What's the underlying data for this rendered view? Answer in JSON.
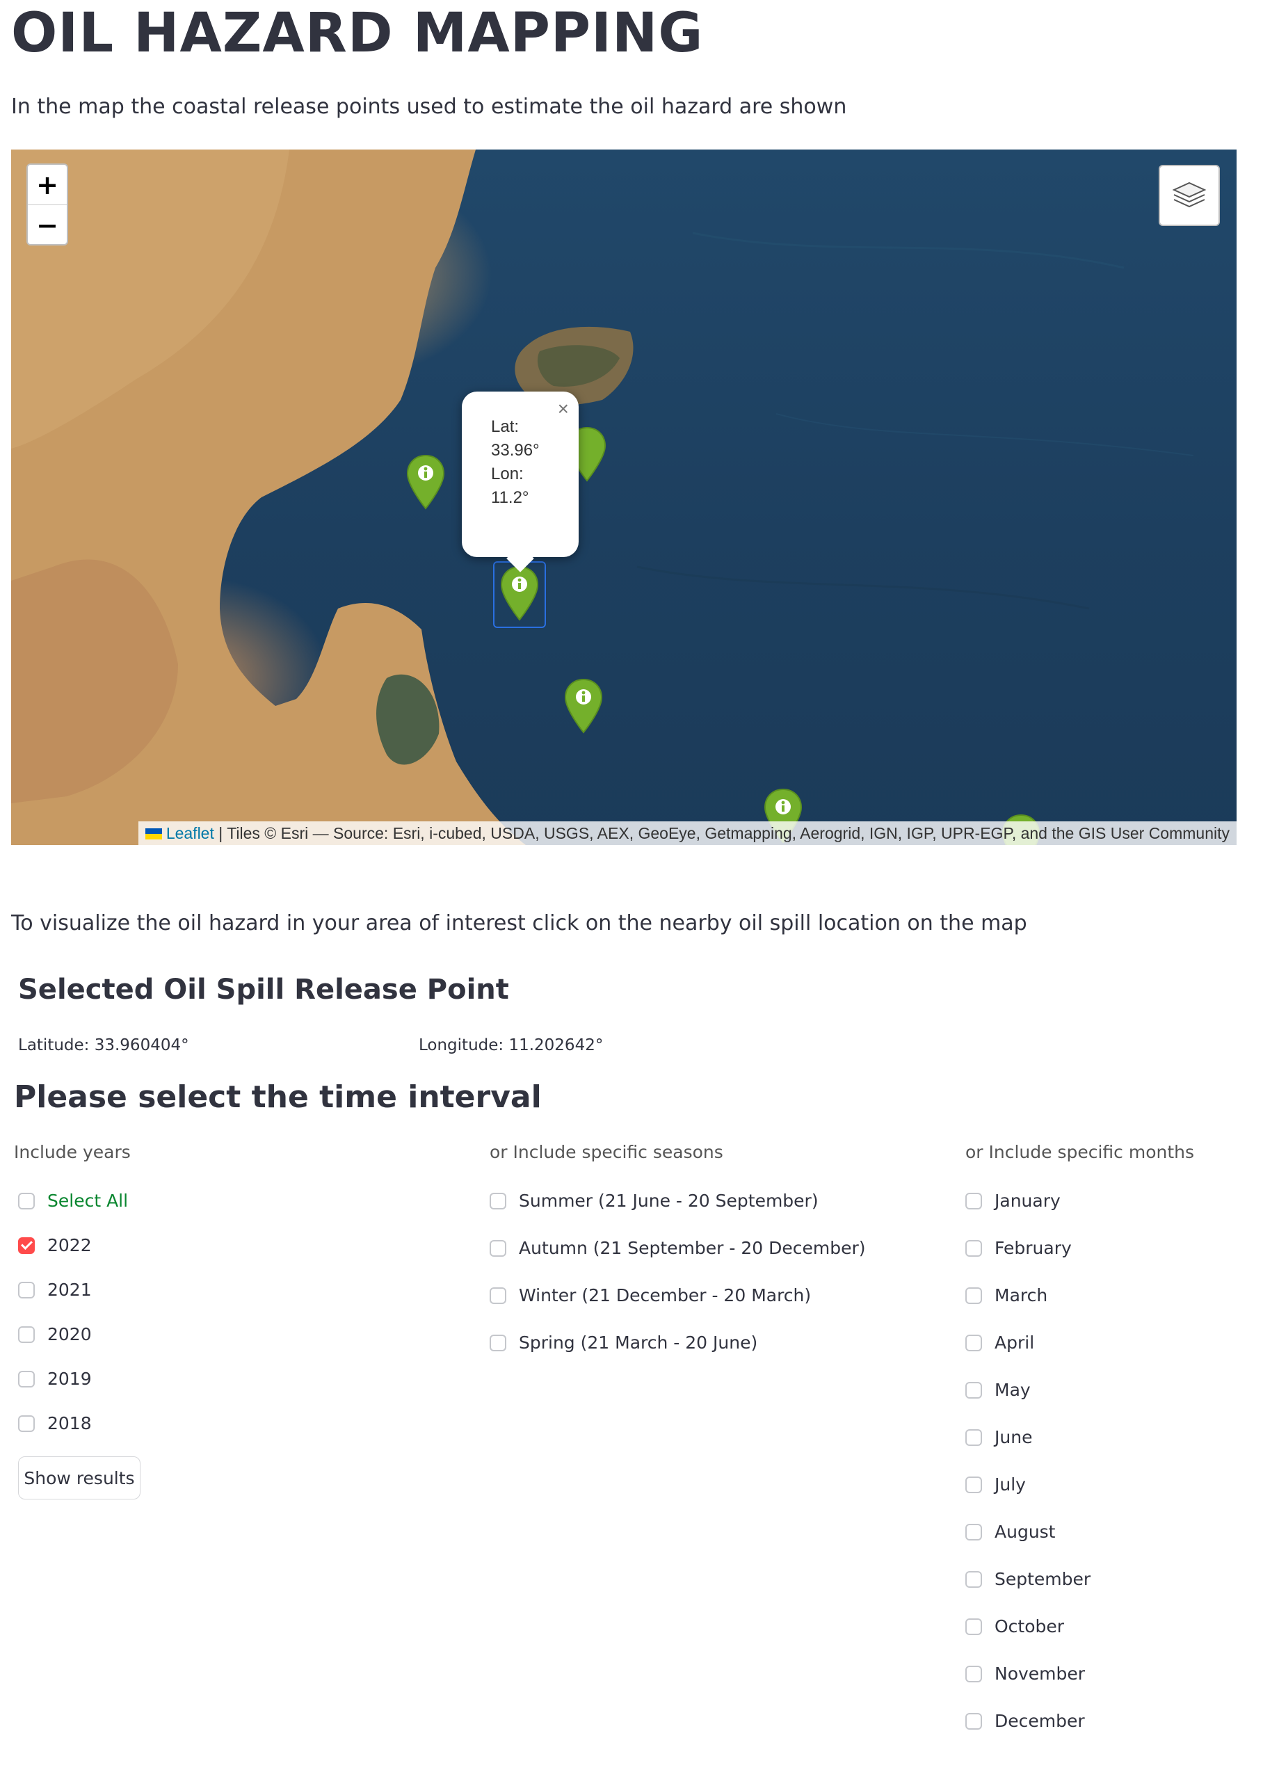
{
  "header": {
    "title": "OIL HAZARD MAPPING",
    "intro": "In the map the coastal release points used to estimate the oil hazard are shown",
    "hint": "To visualize the oil hazard in your area of interest click on the nearby oil spill location on the map"
  },
  "map": {
    "zoom_in": "+",
    "zoom_out": "−",
    "popup": {
      "lat_label": "Lat:",
      "lat_value": "33.96°",
      "lon_label": "Lon:",
      "lon_value": "11.2°",
      "close": "×"
    },
    "attribution": {
      "leaflet": "Leaflet",
      "rest": " | Tiles © Esri — Source: Esri, i-cubed, USDA, USGS, AEX, GeoEye, Getmapping, Aerogrid, IGN, IGP, UPR-EGP, and the GIS User Community"
    },
    "marker_color": "#7cb82f",
    "water_color": "#1d3f5f",
    "land_color": "#c69a63"
  },
  "selected": {
    "title": "Selected Oil Spill Release Point",
    "latitude": "Latitude: 33.960404°",
    "longitude": "Longitude: 11.202642°"
  },
  "interval": {
    "title": "Please select the time interval",
    "years_label": "Include years",
    "seasons_label": "or Include specific seasons",
    "months_label": "or Include specific months",
    "years": [
      {
        "label": "Select All",
        "checked": false
      },
      {
        "label": "2022",
        "checked": true
      },
      {
        "label": "2021",
        "checked": false
      },
      {
        "label": "2020",
        "checked": false
      },
      {
        "label": "2019",
        "checked": false
      },
      {
        "label": "2018",
        "checked": false
      }
    ],
    "seasons": [
      {
        "label": "Summer (21 June - 20 September)",
        "checked": false
      },
      {
        "label": "Autumn (21 September - 20 December)",
        "checked": false
      },
      {
        "label": "Winter (21 December - 20 March)",
        "checked": false
      },
      {
        "label": "Spring (21 March - 20 June)",
        "checked": false
      }
    ],
    "months": [
      {
        "label": "January",
        "checked": false
      },
      {
        "label": "February",
        "checked": false
      },
      {
        "label": "March",
        "checked": false
      },
      {
        "label": "April",
        "checked": false
      },
      {
        "label": "May",
        "checked": false
      },
      {
        "label": "June",
        "checked": false
      },
      {
        "label": "July",
        "checked": false
      },
      {
        "label": "August",
        "checked": false
      },
      {
        "label": "September",
        "checked": false
      },
      {
        "label": "October",
        "checked": false
      },
      {
        "label": "November",
        "checked": false
      },
      {
        "label": "December",
        "checked": false
      }
    ],
    "show_results": "Show results"
  }
}
